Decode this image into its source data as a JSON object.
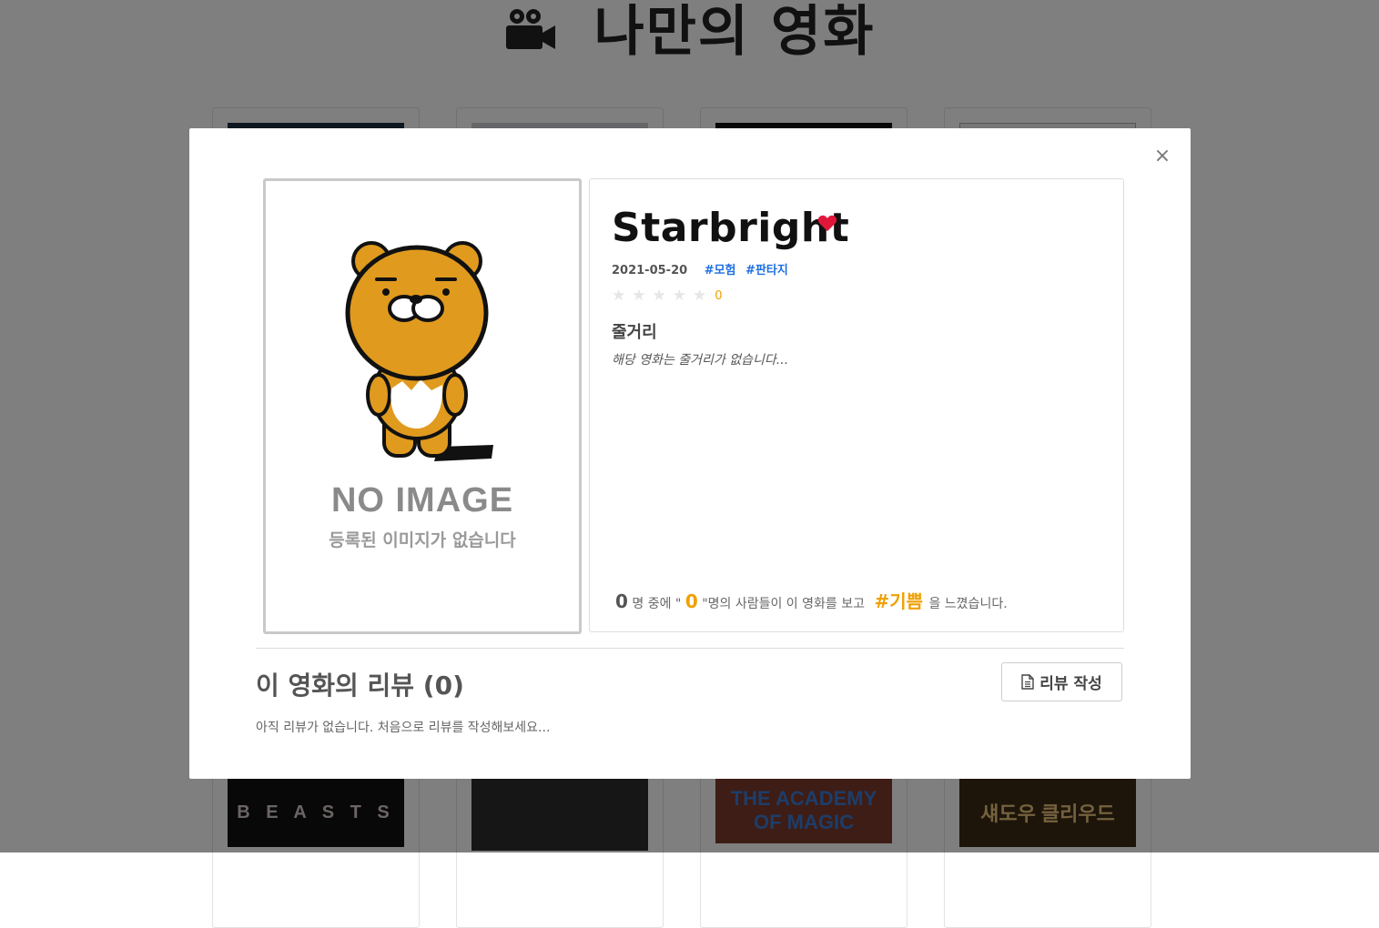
{
  "page": {
    "title": "나만의 영화"
  },
  "background_cards": [
    {
      "bottom_text": "B E A S T S",
      "bottom_color": "#111111",
      "text_color": "#d9c9c9",
      "top_color": "#1e3040"
    },
    {
      "bottom_text": "",
      "bottom_color": "#2c2c2c",
      "text_color": "#ffffff",
      "top_color": "#c8ccd0"
    },
    {
      "bottom_text": "THE ACADEMY OF MAGIC",
      "bottom_color": "#7a3a2a",
      "text_color": "#3a7bd5",
      "top_color": "#111111"
    },
    {
      "bottom_text": "섀도우 클리우드",
      "bottom_color": "#3a2a14",
      "text_color": "#e8c27a",
      "top_color": "#eeeeee"
    }
  ],
  "modal": {
    "close_icon": "×",
    "poster": {
      "no_image_title": "NO IMAGE",
      "no_image_sub": "등록된 이미지가 없습니다"
    },
    "movie": {
      "title": "Starbright",
      "heart_color": "#e0173a",
      "date": "2021-05-20",
      "genres": [
        "#모험",
        "#판타지"
      ],
      "stars": [
        "★",
        "★",
        "★",
        "★",
        "★"
      ],
      "rating": "0",
      "plot_heading": "줄거리",
      "plot_text": "해당 영화는 줄거리가 없습니다..."
    },
    "emotion": {
      "total": "0",
      "text1": "명 중에 \"",
      "count": "0",
      "text2": "\"명의 사람들이 이 영화를 보고",
      "tag": "#기쁨",
      "text3": "을 느꼈습니다."
    },
    "reviews": {
      "heading": "이 영화의 리뷰 (0)",
      "write_button": "리뷰 작성",
      "empty_text": "아직 리뷰가 없습니다. 처음으로 리뷰를 작성해보세요..."
    }
  }
}
